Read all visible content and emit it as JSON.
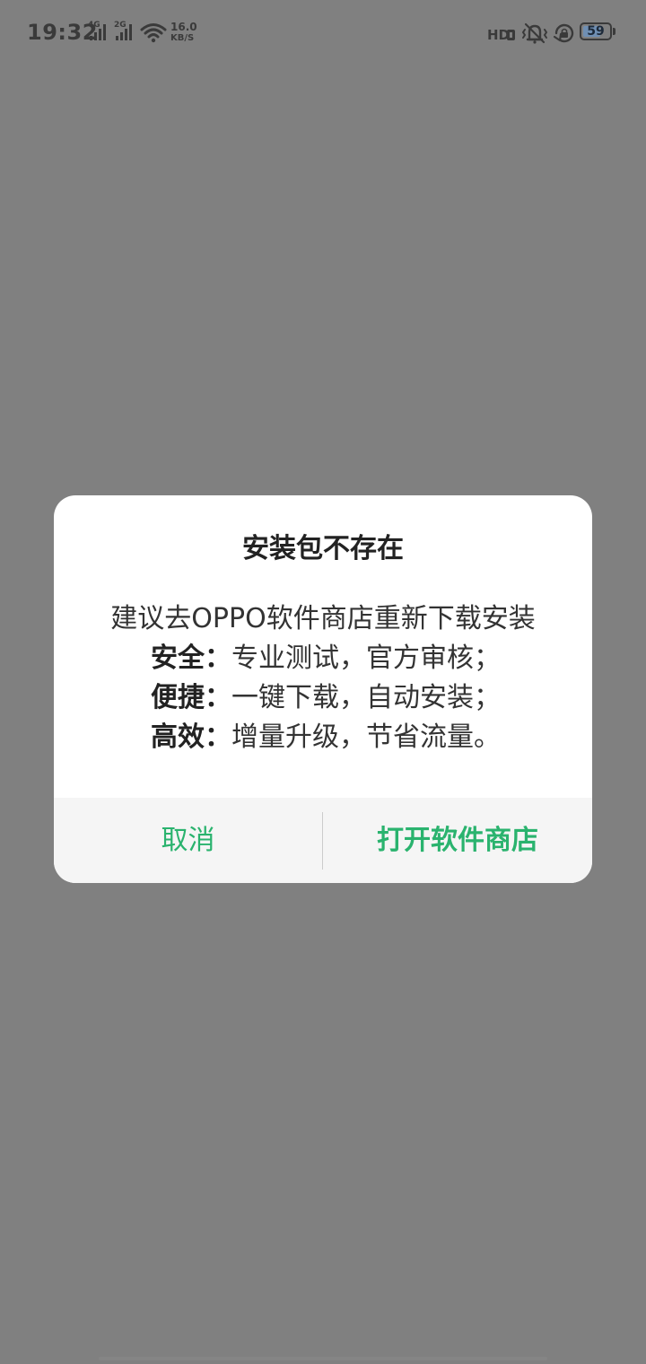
{
  "status_bar": {
    "time": "19:32",
    "sim1_type": "4G",
    "sim2_type": "2G",
    "net_speed_value": "16.0",
    "net_speed_unit": "KB/S",
    "hd_label": "HD",
    "battery_level": "59",
    "icons": [
      "signal-4g-icon",
      "signal-2g-icon",
      "wifi-icon",
      "hd-voice-icon",
      "vibrate-icon",
      "rotation-lock-icon",
      "battery-icon"
    ]
  },
  "dialog": {
    "title": "安装包不存在",
    "intro": "建议去OPPO软件商店重新下载安装",
    "features": [
      {
        "label": "安全：",
        "text": "专业测试，官方审核；"
      },
      {
        "label": "便捷：",
        "text": "一键下载，自动安装；"
      },
      {
        "label": "高效：",
        "text": "增量升级，节省流量。"
      }
    ],
    "cancel_label": "取消",
    "confirm_label": "打开软件商店",
    "accent_color": "#2ab36e"
  }
}
